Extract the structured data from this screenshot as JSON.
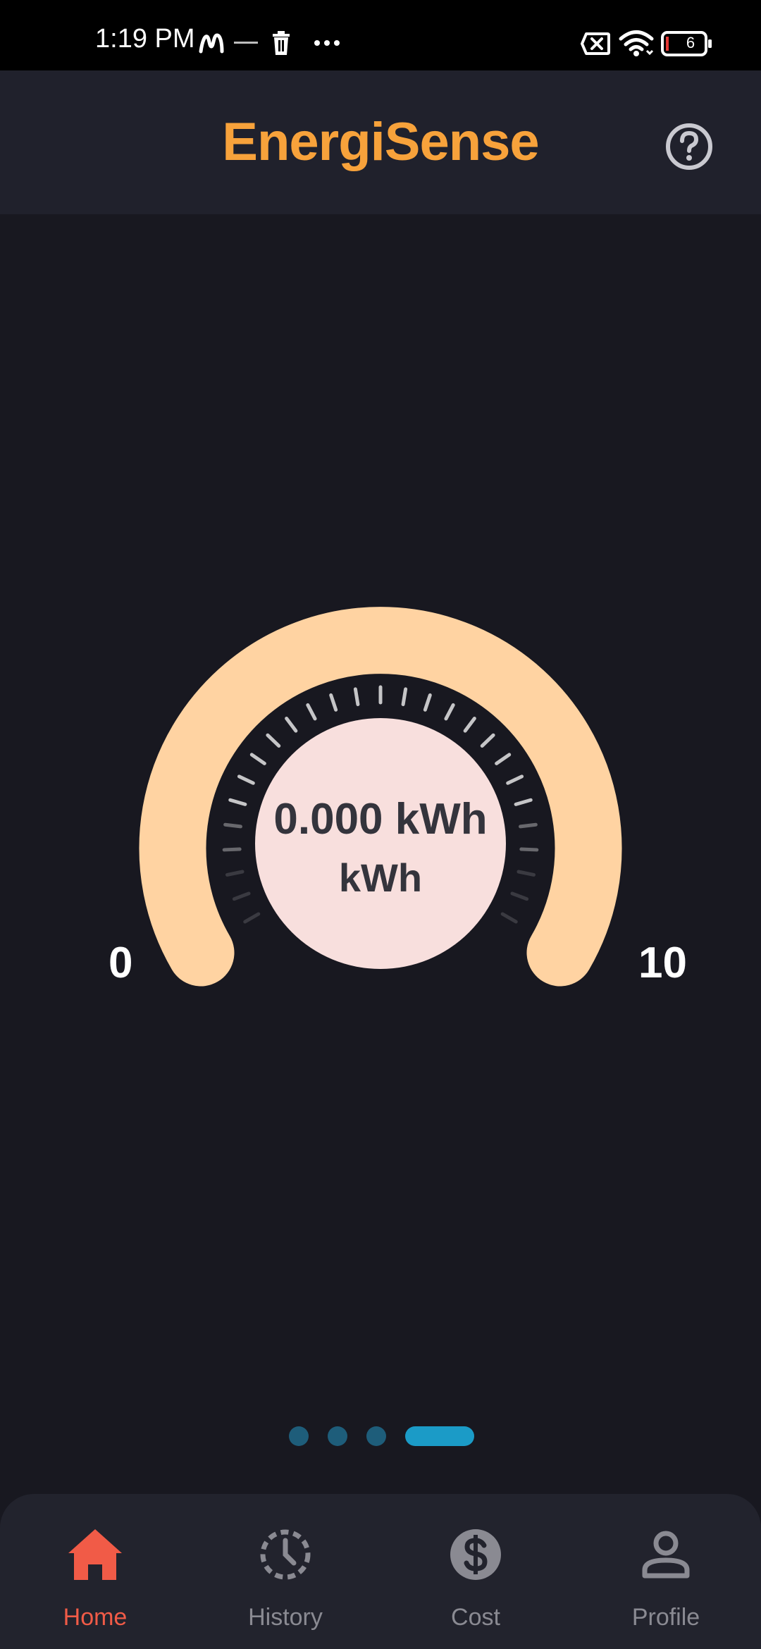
{
  "status_bar": {
    "time": "1:19 PM",
    "battery_level": "6",
    "icons": [
      "m-brand-icon",
      "notification-text-icon",
      "trash-icon",
      "more-dots-icon",
      "sim-blocked-icon",
      "wifi-icon",
      "battery-icon"
    ]
  },
  "header": {
    "title": "EnergiSense",
    "help_icon": "help-circle-icon"
  },
  "gauge": {
    "value_text": "0.000 kWh",
    "unit_text": "kWh",
    "min_label": "0",
    "max_label": "10",
    "value": 0,
    "min": 0,
    "max": 10
  },
  "pager": {
    "count": 4,
    "active_index": 3
  },
  "nav": {
    "items": [
      {
        "label": "Home",
        "icon": "home-icon",
        "active": true
      },
      {
        "label": "History",
        "icon": "history-clock-icon",
        "active": false
      },
      {
        "label": "Cost",
        "icon": "dollar-coin-icon",
        "active": false
      },
      {
        "label": "Profile",
        "icon": "profile-person-icon",
        "active": false
      }
    ]
  },
  "colors": {
    "background": "#181820",
    "header_background": "#20212c",
    "title": "#f7a23b",
    "gauge_arc": "#ffd3a2",
    "gauge_center": "#f8dfdd",
    "nav_active": "#f15b47",
    "nav_inactive": "#8a8a92",
    "pager_active": "#1b9bc7",
    "pager_inactive": "#1e5d7a"
  }
}
